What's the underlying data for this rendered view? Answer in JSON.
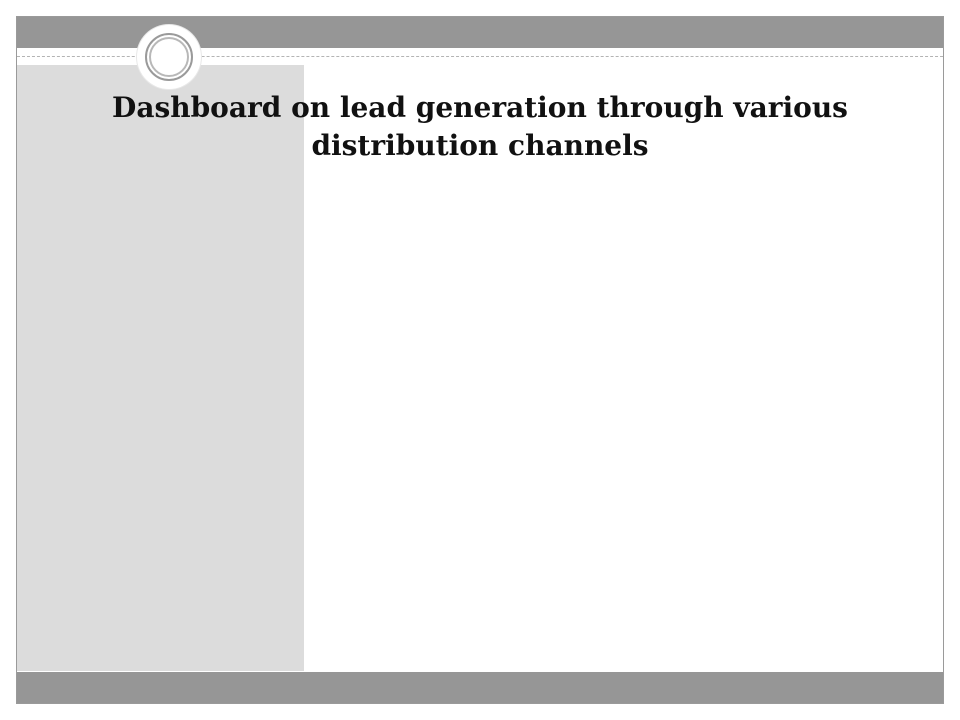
{
  "slide": {
    "title": "Dashboard on lead generation through various distribution channels"
  },
  "colors": {
    "bar": "#969696",
    "side_panel": "#dcdcdc",
    "background": "#ffffff",
    "title_text": "#111111"
  },
  "icons": {
    "ornament": "circle-ornament-icon"
  }
}
